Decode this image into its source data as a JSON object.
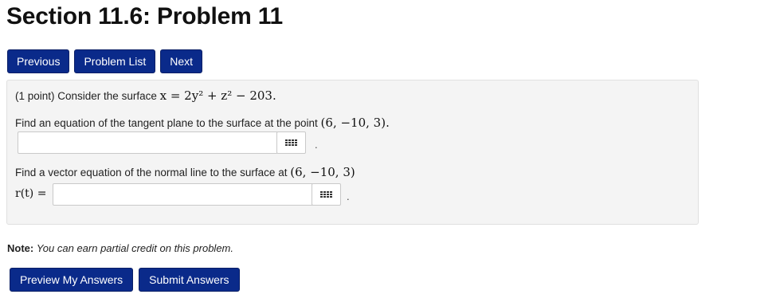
{
  "page_title": "Section 11.6: Problem 11",
  "nav": {
    "previous": "Previous",
    "problem_list": "Problem List",
    "next": "Next"
  },
  "problem": {
    "intro_prefix": "(1 point) Consider the surface",
    "surface_eq": "x = 2y² + z² − 203.",
    "part1_text": "Find an equation of the tangent plane to the surface at the point",
    "part1_point": "(6, −10, 3).",
    "part1_answer": "",
    "part2_text": "Find a vector equation of the normal line to the surface at",
    "part2_point": "(6, −10, 3)",
    "part2_label": "r(t) =",
    "part2_answer": "",
    "trailing_dot": "."
  },
  "note": {
    "label": "Note:",
    "text": "You can earn partial credit on this problem."
  },
  "actions": {
    "preview": "Preview My Answers",
    "submit": "Submit Answers"
  },
  "colors": {
    "button_bg": "#0a2a8a",
    "panel_bg": "#f4f4f4"
  },
  "icons": {
    "equation_editor": "grid-icon"
  }
}
